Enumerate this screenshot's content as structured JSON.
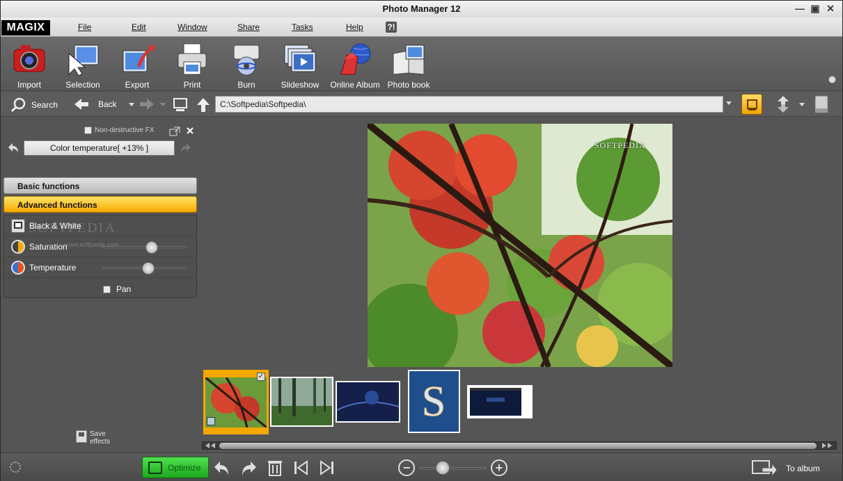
{
  "window": {
    "title": "Photo Manager 12",
    "controls": [
      "minimize",
      "maximize",
      "close"
    ]
  },
  "menubar": {
    "logo": "MAGIX",
    "items": [
      "File",
      "Edit",
      "Window",
      "Share",
      "Tasks",
      "Help"
    ],
    "help_icon": "?!"
  },
  "toolbar": {
    "items": [
      {
        "label": "Import",
        "icon": "camera-icon"
      },
      {
        "label": "Selection",
        "icon": "selection-cursor-icon"
      },
      {
        "label": "Export",
        "icon": "export-icon"
      },
      {
        "label": "Print",
        "icon": "printer-icon"
      },
      {
        "label": "Burn",
        "icon": "disc-burner-icon"
      },
      {
        "label": "Slideshow",
        "icon": "slideshow-icon"
      },
      {
        "label": "Online Album",
        "icon": "online-album-icon"
      },
      {
        "label": "Photo book",
        "icon": "photo-book-icon"
      }
    ]
  },
  "navigation": {
    "search_label": "Search",
    "back_label": "Back",
    "path": "C:\\Softpedia\\Softpedia\\"
  },
  "effects_panel": {
    "non_destructive_label": "Non-destructive FX",
    "non_destructive_checked": false,
    "current_action": "Color temperature[ +13% ]",
    "sections": {
      "basic": "Basic functions",
      "advanced": "Advanced functions"
    },
    "advanced_items": [
      {
        "label": "Black & White",
        "icon": "black-white-icon",
        "has_slider": false
      },
      {
        "label": "Saturation",
        "icon": "saturation-icon",
        "has_slider": true,
        "level": 0.6
      },
      {
        "label": "Temperature",
        "icon": "temperature-icon",
        "has_slider": true,
        "level": 0.55
      }
    ],
    "pan_label": "Pan",
    "pan_checked": false,
    "save_effects_line1": "Save",
    "save_effects_line2": "effects",
    "watermark": "SOFTPEDIA",
    "watermark_sub": "www.softpedia.com"
  },
  "preview": {
    "watermark": "SOFTPEDIA"
  },
  "filmstrip": {
    "thumbnails": [
      {
        "name": "autumn-leaves",
        "selected": true
      },
      {
        "name": "misty-forest",
        "selected": false
      },
      {
        "name": "blue-wallpaper",
        "selected": false
      },
      {
        "name": "softpedia-s-logo",
        "selected": false
      },
      {
        "name": "softpedia-screen",
        "selected": false
      }
    ]
  },
  "bottombar": {
    "optimize_label": "Optimize",
    "to_album_label": "To album",
    "zoom_level": 0.3
  },
  "colors": {
    "accent": "#f4a800",
    "optimize": "#2fc42f",
    "panel_bg": "#555555"
  }
}
